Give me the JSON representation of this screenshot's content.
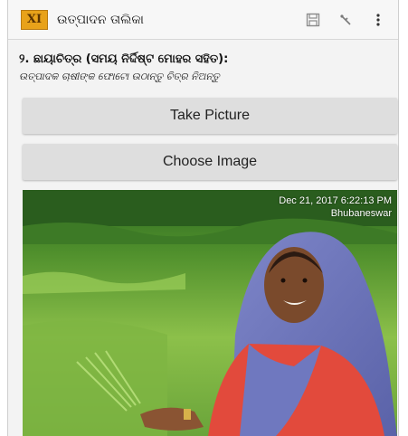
{
  "topbar": {
    "title": "ଉତ୍ପାଦନ ତାଲିକା",
    "icons": [
      "save-icon",
      "gps-icon",
      "overflow-menu-icon"
    ]
  },
  "question": {
    "title": "୨. ଛାୟାଚିତ୍ର (ସମୟ ନିର୍ଦ୍ଦିଷ୍ଟ ମୋହର ସହିତ):",
    "subtitle": "ଉତ୍ପାଦକ ଚାଷୀଙ୍କ ଫୋଟୋ ଉଠାନ୍ତୁ ଚିତ୍ର ନିଅନ୍ତୁ"
  },
  "buttons": {
    "take_picture": "Take Picture",
    "choose_image": "Choose Image"
  },
  "photo": {
    "timestamp": "Dec 21, 2017 6:22:13 PM",
    "location": "Bhubaneswar"
  }
}
